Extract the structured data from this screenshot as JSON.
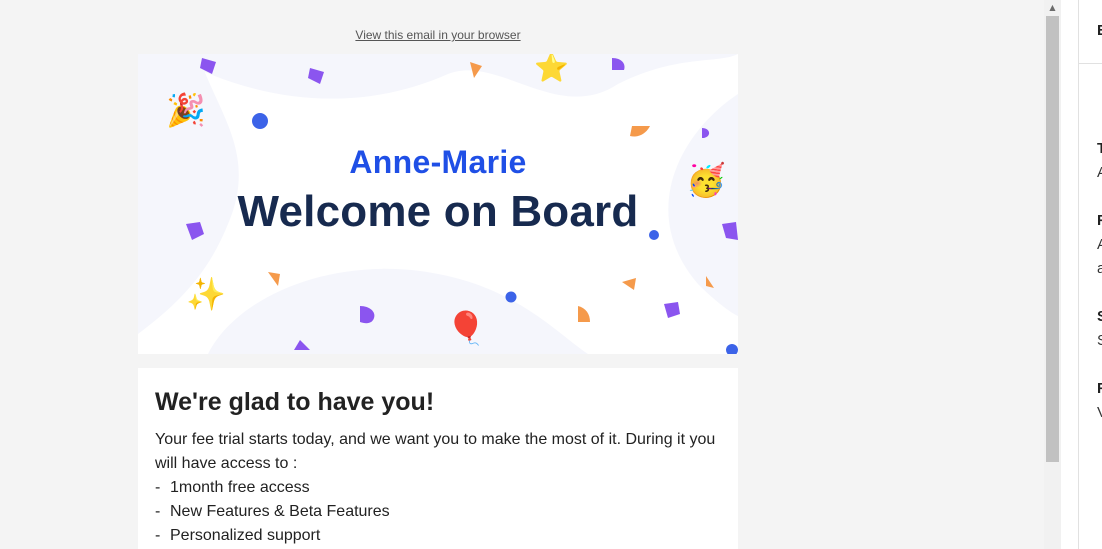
{
  "email": {
    "view_in_browser": "View this email in your browser",
    "hero": {
      "name": "Anne-Marie",
      "title": "Welcome on Board",
      "emojis": {
        "party_popper": "🎉",
        "star": "⭐",
        "partying_face": "🥳",
        "sparkles": "✨",
        "balloon": "🎈"
      }
    },
    "body": {
      "heading": "We're glad to have you!",
      "intro": "Your fee trial starts today, and we want you to make the most of it. During it you will have access to :",
      "features": [
        "1month free access",
        "New Features & Beta Features",
        "Personalized support"
      ],
      "bullet": "-"
    }
  },
  "scrollbar": {
    "up_arrow": "▲",
    "down_arrow": "▼"
  },
  "side_panel": {
    "header_initial": "E",
    "rows": [
      {
        "label": "T",
        "value": "A"
      },
      {
        "label": "F",
        "value": "A",
        "value2": "a"
      },
      {
        "label": "S",
        "value": "S"
      },
      {
        "label": "F",
        "value": "V"
      }
    ]
  },
  "colors": {
    "accent_blue": "#1f4fe6",
    "title_navy": "#172a4f",
    "confetti_purple": "#8b55ef",
    "confetti_orange": "#f59a4b",
    "confetti_blue": "#3c63e8"
  }
}
